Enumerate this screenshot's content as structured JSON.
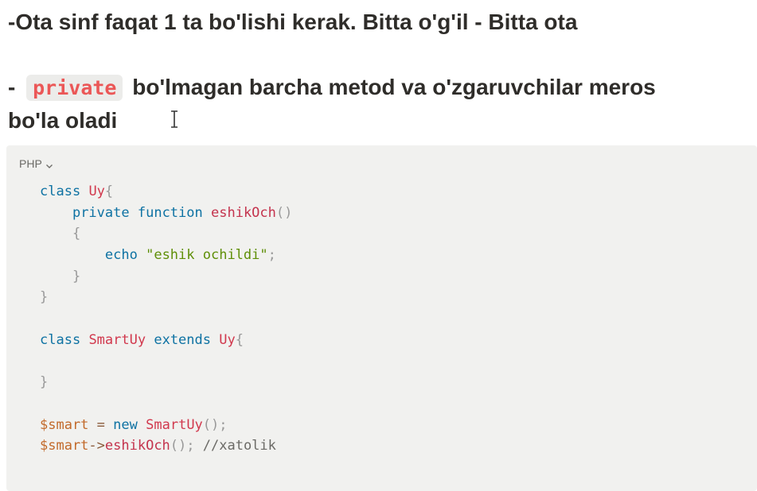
{
  "heading1": "-Ota sinf faqat 1 ta bo'lishi kerak. Bitta o'g'il - Bitta ota",
  "heading2": {
    "prefix": "- ",
    "code": "private",
    "suffix": " bo'lmagan barcha metod va o'zgaruvchilar meros"
  },
  "heading3": "bo'la oladi",
  "code_block": {
    "language": "PHP",
    "lines": [
      [
        {
          "t": "class",
          "c": "kw"
        },
        {
          "t": " "
        },
        {
          "t": "Uy",
          "c": "cls"
        },
        {
          "t": "{",
          "c": "punc"
        }
      ],
      [
        {
          "t": "    "
        },
        {
          "t": "private",
          "c": "kw"
        },
        {
          "t": " "
        },
        {
          "t": "function",
          "c": "kw"
        },
        {
          "t": " "
        },
        {
          "t": "eshikOch",
          "c": "fn"
        },
        {
          "t": "()",
          "c": "punc"
        }
      ],
      [
        {
          "t": "    "
        },
        {
          "t": "{",
          "c": "punc"
        }
      ],
      [
        {
          "t": "        "
        },
        {
          "t": "echo",
          "c": "kw"
        },
        {
          "t": " "
        },
        {
          "t": "\"eshik ochildi\"",
          "c": "str"
        },
        {
          "t": ";",
          "c": "punc"
        }
      ],
      [
        {
          "t": "    "
        },
        {
          "t": "}",
          "c": "punc"
        }
      ],
      [
        {
          "t": "}",
          "c": "punc"
        }
      ],
      [],
      [
        {
          "t": "class",
          "c": "kw"
        },
        {
          "t": " "
        },
        {
          "t": "SmartUy",
          "c": "cls"
        },
        {
          "t": " "
        },
        {
          "t": "extends",
          "c": "kw"
        },
        {
          "t": " "
        },
        {
          "t": "Uy",
          "c": "cls"
        },
        {
          "t": "{",
          "c": "punc"
        }
      ],
      [],
      [
        {
          "t": "}",
          "c": "punc"
        }
      ],
      [],
      [
        {
          "t": "$smart",
          "c": "var"
        },
        {
          "t": " "
        },
        {
          "t": "=",
          "c": "op"
        },
        {
          "t": " "
        },
        {
          "t": "new",
          "c": "kw"
        },
        {
          "t": " "
        },
        {
          "t": "SmartUy",
          "c": "cls"
        },
        {
          "t": "();",
          "c": "punc"
        }
      ],
      [
        {
          "t": "$smart",
          "c": "var"
        },
        {
          "t": "->",
          "c": "op"
        },
        {
          "t": "eshikOch",
          "c": "fn"
        },
        {
          "t": "();",
          "c": "punc"
        },
        {
          "t": " "
        },
        {
          "t": "//xatolik",
          "c": "cmt"
        }
      ]
    ]
  },
  "colors": {
    "keyword": "#0e72a3",
    "class_name": "#d1384d",
    "string": "#5f8f08",
    "variable": "#c2692a",
    "inline_code": "#eb5757",
    "code_background": "#f1f1ef"
  },
  "icons": {
    "language_dropdown": "chevron-down-icon",
    "cursor": "text-cursor-icon"
  }
}
